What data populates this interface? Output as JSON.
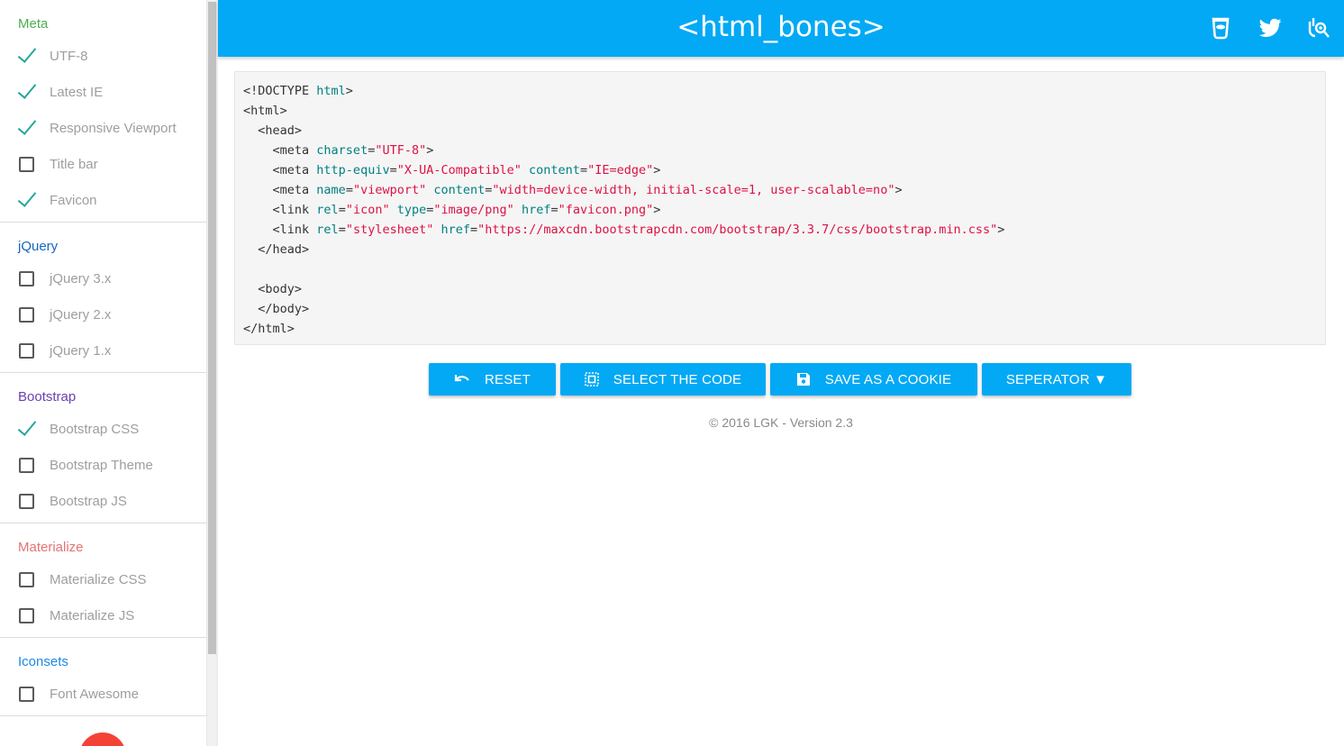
{
  "sidebar": {
    "sections": [
      {
        "title": "Meta",
        "color": "#4caf50",
        "items": [
          {
            "label": "UTF-8",
            "checked": true
          },
          {
            "label": "Latest IE",
            "checked": true
          },
          {
            "label": "Responsive Viewport",
            "checked": true
          },
          {
            "label": "Title bar",
            "checked": false
          },
          {
            "label": "Favicon",
            "checked": true
          }
        ]
      },
      {
        "title": "jQuery",
        "color": "#1565c0",
        "items": [
          {
            "label": "jQuery 3.x",
            "checked": false
          },
          {
            "label": "jQuery 2.x",
            "checked": false
          },
          {
            "label": "jQuery 1.x",
            "checked": false
          }
        ]
      },
      {
        "title": "Bootstrap",
        "color": "#6a3fb0",
        "items": [
          {
            "label": "Bootstrap CSS",
            "checked": true
          },
          {
            "label": "Bootstrap Theme",
            "checked": false
          },
          {
            "label": "Bootstrap JS",
            "checked": false
          }
        ]
      },
      {
        "title": "Materialize",
        "color": "#e57373",
        "items": [
          {
            "label": "Materialize CSS",
            "checked": false
          },
          {
            "label": "Materialize JS",
            "checked": false
          }
        ]
      },
      {
        "title": "Iconsets",
        "color": "#1e88e5",
        "items": [
          {
            "label": "Font Awesome",
            "checked": false
          }
        ]
      }
    ]
  },
  "header": {
    "title": "<html_bones>",
    "icons": [
      "bower-icon",
      "twitter-icon",
      "github-icon"
    ]
  },
  "code": {
    "lines": [
      {
        "indent": "",
        "parts": [
          [
            "t",
            "<!DOCTYPE "
          ],
          [
            "a",
            "html"
          ],
          [
            "t",
            ">"
          ]
        ]
      },
      {
        "indent": "",
        "parts": [
          [
            "t",
            "<html>"
          ]
        ]
      },
      {
        "indent": "  ",
        "parts": [
          [
            "t",
            "<head>"
          ]
        ]
      },
      {
        "indent": "    ",
        "parts": [
          [
            "t",
            "<meta "
          ],
          [
            "a",
            "charset"
          ],
          [
            "t",
            "="
          ],
          [
            "s",
            "\"UTF-8\""
          ],
          [
            "t",
            ">"
          ]
        ]
      },
      {
        "indent": "    ",
        "parts": [
          [
            "t",
            "<meta "
          ],
          [
            "a",
            "http-equiv"
          ],
          [
            "t",
            "="
          ],
          [
            "s",
            "\"X-UA-Compatible\""
          ],
          [
            "t",
            " "
          ],
          [
            "a",
            "content"
          ],
          [
            "t",
            "="
          ],
          [
            "s",
            "\"IE=edge\""
          ],
          [
            "t",
            ">"
          ]
        ]
      },
      {
        "indent": "    ",
        "parts": [
          [
            "t",
            "<meta "
          ],
          [
            "a",
            "name"
          ],
          [
            "t",
            "="
          ],
          [
            "s",
            "\"viewport\""
          ],
          [
            "t",
            " "
          ],
          [
            "a",
            "content"
          ],
          [
            "t",
            "="
          ],
          [
            "s",
            "\"width=device-width, initial-scale=1, user-scalable=no\""
          ],
          [
            "t",
            ">"
          ]
        ]
      },
      {
        "indent": "    ",
        "parts": [
          [
            "t",
            "<link "
          ],
          [
            "a",
            "rel"
          ],
          [
            "t",
            "="
          ],
          [
            "s",
            "\"icon\""
          ],
          [
            "t",
            " "
          ],
          [
            "a",
            "type"
          ],
          [
            "t",
            "="
          ],
          [
            "s",
            "\"image/png\""
          ],
          [
            "t",
            " "
          ],
          [
            "a",
            "href"
          ],
          [
            "t",
            "="
          ],
          [
            "s",
            "\"favicon.png\""
          ],
          [
            "t",
            ">"
          ]
        ]
      },
      {
        "indent": "    ",
        "parts": [
          [
            "t",
            "<link "
          ],
          [
            "a",
            "rel"
          ],
          [
            "t",
            "="
          ],
          [
            "s",
            "\"stylesheet\""
          ],
          [
            "t",
            " "
          ],
          [
            "a",
            "href"
          ],
          [
            "t",
            "="
          ],
          [
            "s",
            "\"https://maxcdn.bootstrapcdn.com/bootstrap/3.3.7/css/bootstrap.min.css\""
          ],
          [
            "t",
            ">"
          ]
        ]
      },
      {
        "indent": "  ",
        "parts": [
          [
            "t",
            "</head>"
          ]
        ]
      },
      {
        "indent": "",
        "parts": []
      },
      {
        "indent": "  ",
        "parts": [
          [
            "t",
            "<body>"
          ]
        ]
      },
      {
        "indent": "  ",
        "parts": [
          [
            "t",
            "</body>"
          ]
        ]
      },
      {
        "indent": "",
        "parts": [
          [
            "t",
            "</html>"
          ]
        ]
      }
    ]
  },
  "buttons": {
    "reset": "RESET",
    "select": "SELECT THE CODE",
    "cookie": "SAVE AS A COOKIE",
    "separator": "SEPERATOR ▼"
  },
  "footer": {
    "text": "© 2016 LGK - Version 2.3"
  },
  "colors": {
    "accent": "#03a9f4",
    "check": "#26a69a",
    "fab": "#f44336"
  }
}
